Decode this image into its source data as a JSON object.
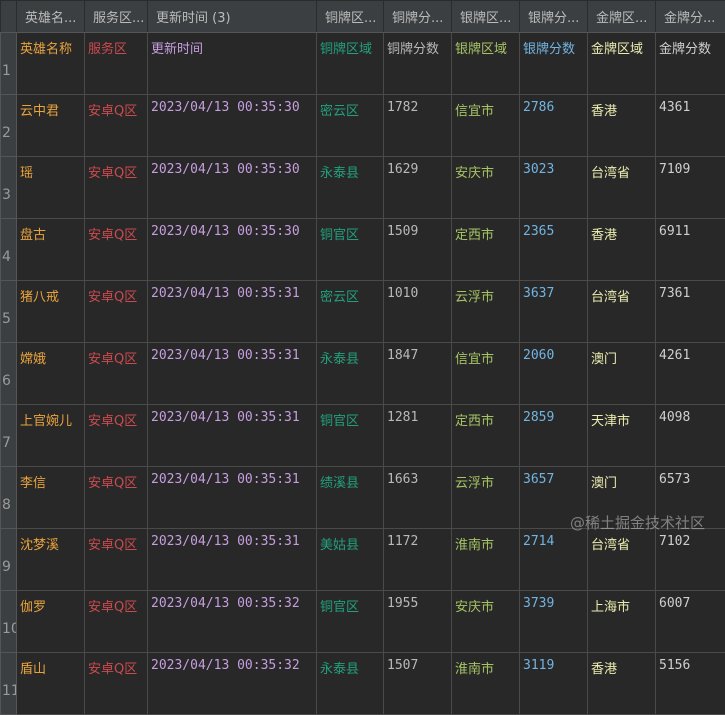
{
  "columns": [
    "英雄名...",
    "服务区...",
    "更新时间 (3)",
    "铜牌区...",
    "铜牌分...",
    "银牌区...",
    "银牌分...",
    "金牌区...",
    "金牌分..."
  ],
  "rows": [
    {
      "n": "1",
      "name": "英雄名称",
      "server": "服务区",
      "time": "更新时间",
      "breg": "铜牌区域",
      "bsc": "铜牌分数",
      "sreg": "银牌区域",
      "ssc": "银牌分数",
      "greg": "金牌区域",
      "gsc": "金牌分数"
    },
    {
      "n": "2",
      "name": "云中君",
      "server": "安卓Q区",
      "time": "2023/04/13 00:35:30",
      "breg": "密云区",
      "bsc": "1782",
      "sreg": "信宜市",
      "ssc": "2786",
      "greg": "香港",
      "gsc": "4361"
    },
    {
      "n": "3",
      "name": "瑶",
      "server": "安卓Q区",
      "time": "2023/04/13 00:35:30",
      "breg": "永泰县",
      "bsc": "1629",
      "sreg": "安庆市",
      "ssc": "3023",
      "greg": "台湾省",
      "gsc": "7109"
    },
    {
      "n": "4",
      "name": "盘古",
      "server": "安卓Q区",
      "time": "2023/04/13 00:35:30",
      "breg": "铜官区",
      "bsc": "1509",
      "sreg": "定西市",
      "ssc": "2365",
      "greg": "香港",
      "gsc": "6911"
    },
    {
      "n": "5",
      "name": "猪八戒",
      "server": "安卓Q区",
      "time": "2023/04/13 00:35:31",
      "breg": "密云区",
      "bsc": "1010",
      "sreg": "云浮市",
      "ssc": "3637",
      "greg": "台湾省",
      "gsc": "7361"
    },
    {
      "n": "6",
      "name": "嫦娥",
      "server": "安卓Q区",
      "time": "2023/04/13 00:35:31",
      "breg": "永泰县",
      "bsc": "1847",
      "sreg": "信宜市",
      "ssc": "2060",
      "greg": "澳门",
      "gsc": "4261"
    },
    {
      "n": "7",
      "name": "上官婉儿",
      "server": "安卓Q区",
      "time": "2023/04/13 00:35:31",
      "breg": "铜官区",
      "bsc": "1281",
      "sreg": "定西市",
      "ssc": "2859",
      "greg": "天津市",
      "gsc": "4098"
    },
    {
      "n": "8",
      "name": "李信",
      "server": "安卓Q区",
      "time": "2023/04/13 00:35:31",
      "breg": "绩溪县",
      "bsc": "1663",
      "sreg": "云浮市",
      "ssc": "3657",
      "greg": "澳门",
      "gsc": "6573"
    },
    {
      "n": "9",
      "name": "沈梦溪",
      "server": "安卓Q区",
      "time": "2023/04/13 00:35:31",
      "breg": "美姑县",
      "bsc": "1172",
      "sreg": "淮南市",
      "ssc": "2714",
      "greg": "台湾省",
      "gsc": "7102"
    },
    {
      "n": "10",
      "name": "伽罗",
      "server": "安卓Q区",
      "time": "2023/04/13 00:35:32",
      "breg": "铜官区",
      "bsc": "1955",
      "sreg": "安庆市",
      "ssc": "3739",
      "greg": "上海市",
      "gsc": "6007"
    },
    {
      "n": "11",
      "name": "盾山",
      "server": "安卓Q区",
      "time": "2023/04/13 00:35:32",
      "breg": "永泰县",
      "bsc": "1507",
      "sreg": "淮南市",
      "ssc": "3119",
      "greg": "香港",
      "gsc": "5156"
    }
  ],
  "watermark": "@稀土掘金技术社区"
}
